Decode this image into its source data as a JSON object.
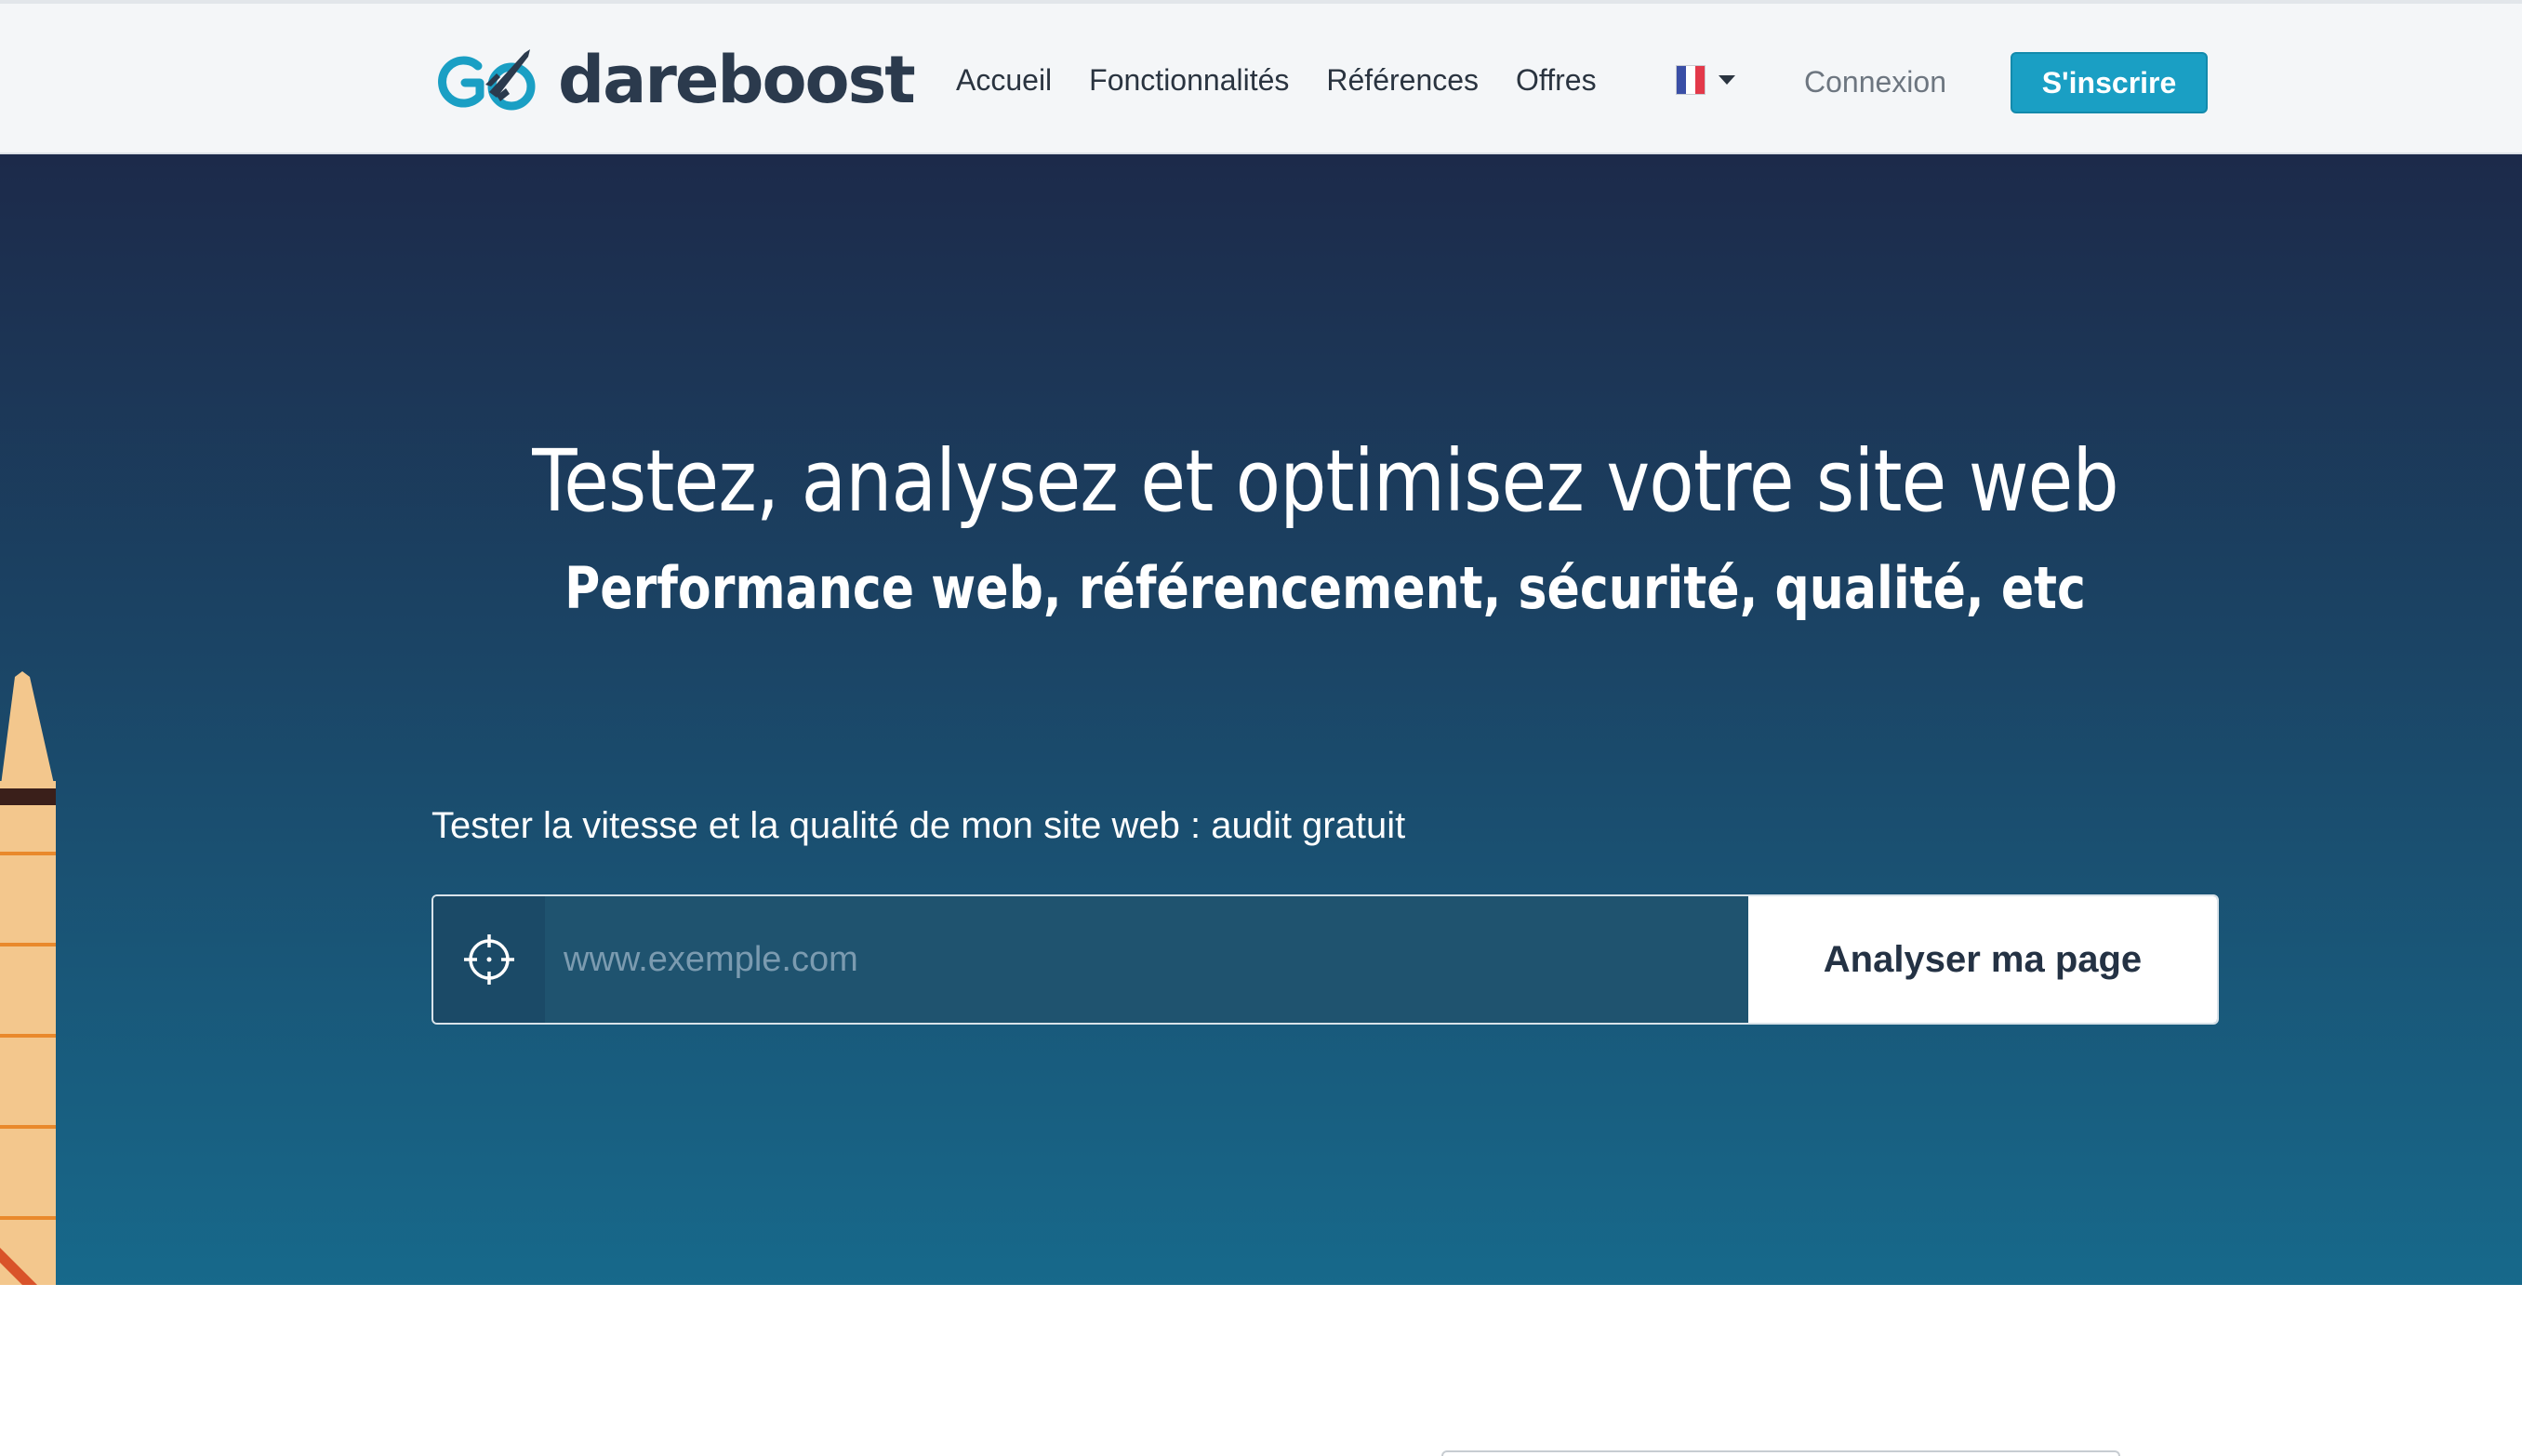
{
  "brand": {
    "name": "dareboost",
    "primary_color": "#2b3a4d",
    "accent_color": "#1a9fc4"
  },
  "nav": {
    "items": [
      {
        "label": "Accueil"
      },
      {
        "label": "Fonctionnalités"
      },
      {
        "label": "Références"
      },
      {
        "label": "Offres"
      }
    ],
    "language": {
      "current": "FR",
      "icon": "french-flag-icon"
    },
    "login_label": "Connexion",
    "signup_label": "S'inscrire"
  },
  "hero": {
    "title": "Testez, analysez et optimisez votre site web",
    "subtitle": "Performance web, référencement, sécurité, qualité, etc",
    "test_label": "Tester la vitesse et la qualité de mon site web : audit gratuit",
    "url_input": {
      "value": "",
      "placeholder": "www.exemple.com",
      "icon": "crosshair-target-icon"
    },
    "analyze_button_label": "Analyser ma page",
    "background_top": "#1c2a4a",
    "background_bottom": "#17698b"
  }
}
